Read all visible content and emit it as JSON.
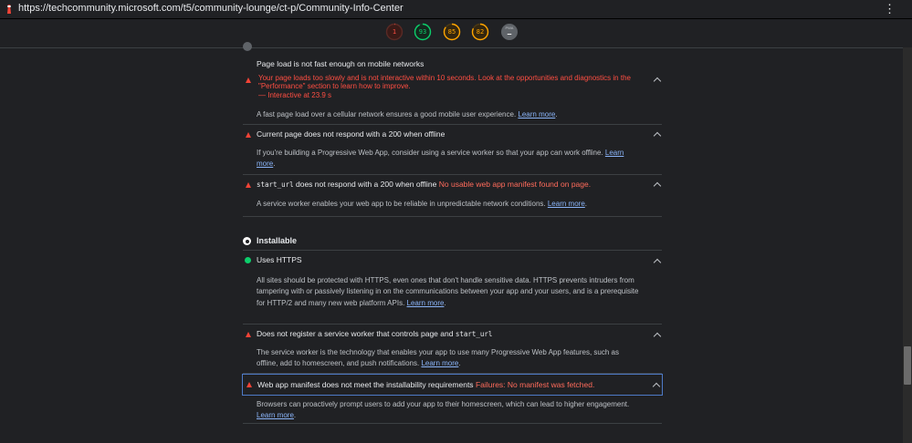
{
  "browser": {
    "url": "https://techcommunity.microsoft.com/t5/community-lounge/ct-p/Community-Info-Center",
    "favicon": "lighthouse-icon",
    "menu_icon": "⋮"
  },
  "scores": [
    {
      "label": "1",
      "value": 1,
      "color": "#ff4e42",
      "name": "performance"
    },
    {
      "label": "93",
      "value": 93,
      "color": "#0cce6b",
      "name": "accessibility"
    },
    {
      "label": "85",
      "value": 85,
      "color": "#ffa400",
      "name": "best-practices"
    },
    {
      "label": "82",
      "value": 82,
      "color": "#ffa400",
      "name": "seo"
    },
    {
      "label": "PWA",
      "dash": "–",
      "name": "pwa"
    }
  ],
  "audits_fast_reliable": [
    {
      "title": "Page load is not fast enough on mobile networks",
      "error": "Your page loads too slowly and is not interactive within 10 seconds. Look at the opportunities and diagnostics in the \"Performance\" section to learn how to improve.",
      "detail": "— Interactive at 23.9 s",
      "description": "A fast page load over a cellular network ensures a good mobile user experience.",
      "link": "Learn more",
      "status": "fail"
    },
    {
      "title": "Current page does not respond with a 200 when offline",
      "description_a": "If you're building a Progressive Web App, consider using a service worker so that your app can work offline.",
      "link_a": "Learn",
      "link_b": "more",
      "status": "fail"
    },
    {
      "title_code": "start_url",
      "title_rest": " does not respond with a 200 when offline",
      "error": "No usable web app manifest found on page.",
      "description": "A service worker enables your web app to be reliable in unpredictable network conditions.",
      "link": "Learn more",
      "status": "fail"
    }
  ],
  "installable": {
    "heading": "Installable",
    "audits": [
      {
        "title": "Uses HTTPS",
        "description_l1": "All sites should be protected with HTTPS, even ones that don't handle sensitive data. HTTPS prevents intruders from",
        "description_l2": "tampering with or passively listening in on the communications between your app and your users, and is a prerequisite",
        "description_l3": "for HTTP/2 and many new web platform APIs.",
        "link": "Learn more",
        "status": "pass"
      },
      {
        "title_prefix": "Does not register a service worker that controls page and ",
        "title_code": "start_url",
        "description_l1": "The service worker is the technology that enables your app to use many Progressive Web App features, such as",
        "description_l2": "offline, add to homescreen, and push notifications.",
        "link": "Learn more",
        "status": "fail"
      },
      {
        "title": "Web app manifest does not meet the installability requirements",
        "error": "Failures: No manifest was fetched.",
        "description": "Browsers can proactively prompt users to add your app to their homescreen, which can lead to higher engagement.",
        "link": "Learn more",
        "status": "fail"
      }
    ]
  }
}
